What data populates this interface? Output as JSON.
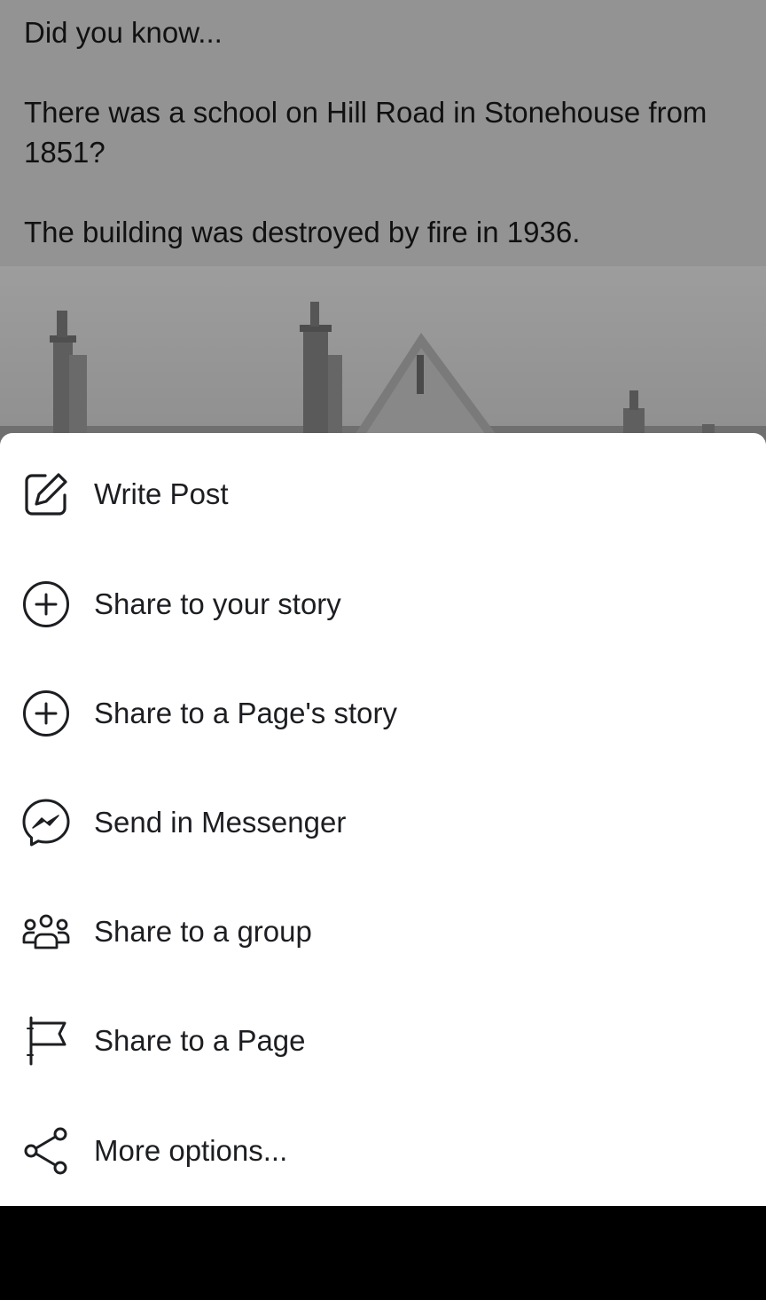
{
  "post": {
    "line1": "Did you know...",
    "line2": "There was a school on Hill Road in Stonehouse from 1851?",
    "line3": "The building was destroyed by fire in 1936."
  },
  "share_sheet": {
    "options": [
      {
        "label": "Write Post",
        "icon": "edit-icon"
      },
      {
        "label": "Share to your story",
        "icon": "plus-circle-icon"
      },
      {
        "label": "Share to a Page's story",
        "icon": "plus-circle-icon"
      },
      {
        "label": "Send in Messenger",
        "icon": "messenger-icon"
      },
      {
        "label": "Share to a group",
        "icon": "group-icon"
      },
      {
        "label": "Share to a Page",
        "icon": "flag-icon"
      },
      {
        "label": "More options...",
        "icon": "share-icon"
      }
    ]
  }
}
